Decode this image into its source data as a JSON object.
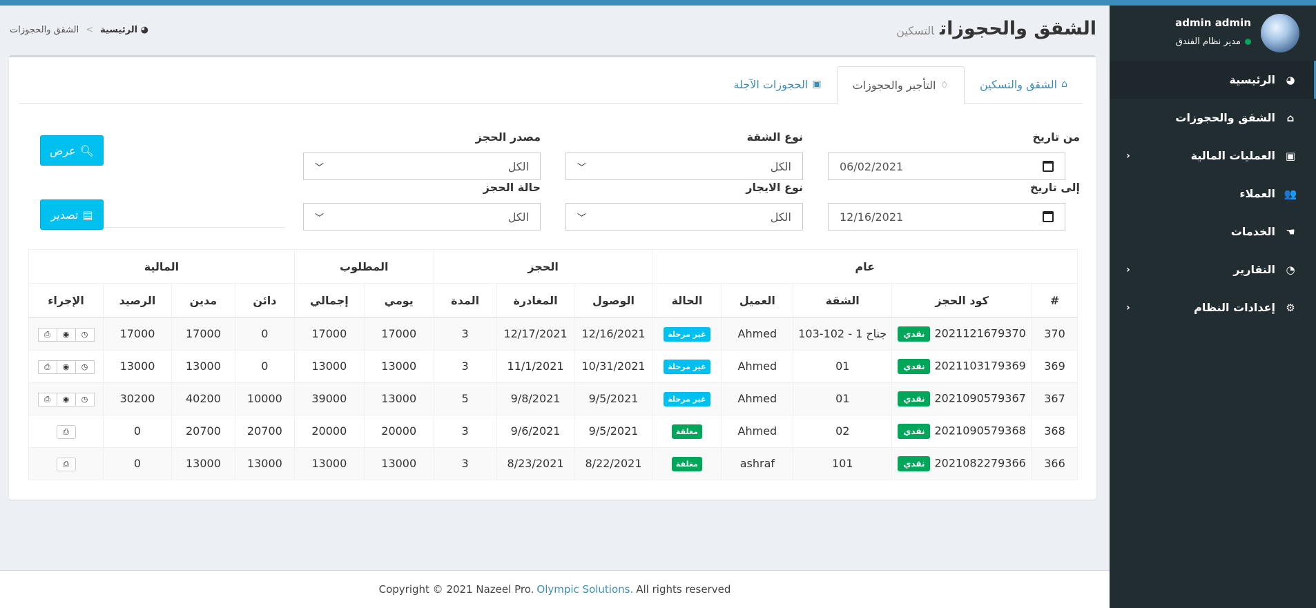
{
  "user": {
    "name": "admin admin",
    "role": "مدير نظام الفندق"
  },
  "sidebar": {
    "items": [
      {
        "label": "الرئيسية",
        "icon": "dashboard-icon",
        "active": true
      },
      {
        "label": "الشقق والحجوزات",
        "icon": "home-icon"
      },
      {
        "label": "العمليات المالية",
        "icon": "money-icon",
        "expandable": true
      },
      {
        "label": "العملاء",
        "icon": "users-icon"
      },
      {
        "label": "الخدمات",
        "icon": "hand-icon"
      },
      {
        "label": "التقارير",
        "icon": "pie-chart-icon",
        "expandable": true
      },
      {
        "label": "إعدادات النظام",
        "icon": "gears-icon",
        "expandable": true
      }
    ]
  },
  "header": {
    "title": "الشقق والحجوزات",
    "subtitle": "التسكين"
  },
  "breadcrumb": {
    "home": "الرئيسية",
    "current": "الشقق والحجوزات"
  },
  "tabs": [
    {
      "label": "الشقق والتسكين",
      "icon": "home-icon"
    },
    {
      "label": "التأجير والحجوزات",
      "icon": "lightbulb-icon",
      "active": true
    },
    {
      "label": "الحجوزات الآجلة",
      "icon": "money-icon"
    }
  ],
  "filters": {
    "from_date": {
      "label": "من تاريخ",
      "value": "06/02/2021"
    },
    "to_date": {
      "label": "إلى تاريخ",
      "value": "12/16/2021"
    },
    "apartment_type": {
      "label": "نوع الشقة",
      "value": "الكل"
    },
    "rent_type": {
      "label": "نوع الايجار",
      "value": "الكل"
    },
    "booking_source": {
      "label": "مصدر الحجز",
      "value": "الكل"
    },
    "booking_status": {
      "label": "حالة الحجز",
      "value": "الكل"
    }
  },
  "buttons": {
    "view": "عرض",
    "export": "تصدير"
  },
  "table": {
    "groups": {
      "general": "عام",
      "booking": "الحجز",
      "required": "المطلوب",
      "financial": "المالية"
    },
    "columns": {
      "num": "#",
      "code": "كود الحجز",
      "apartment": "الشقة",
      "client": "العميل",
      "status": "الحالة",
      "arrival": "الوصول",
      "departure": "المغادرة",
      "duration": "المدة",
      "daily": "يومي",
      "total": "إجمالي",
      "credit": "دائن",
      "debit": "مدين",
      "balance": "الرصيد",
      "action": "الإجراء"
    },
    "rows": [
      {
        "num": "370",
        "code": "2021121679370",
        "pay": "نقدي",
        "apartment": "جناح 1 - 102-103",
        "client": "Ahmed",
        "status": "غير مرحلة",
        "status_kind": "open",
        "arrival": "12/16/2021",
        "departure": "12/17/2021",
        "duration": "3",
        "daily": "17000",
        "total": "17000",
        "credit": "0",
        "debit": "17000",
        "balance": "17000",
        "actions": [
          "print",
          "view",
          "clock"
        ]
      },
      {
        "num": "369",
        "code": "2021103179369",
        "pay": "نقدي",
        "apartment": "01",
        "client": "Ahmed",
        "status": "غير مرحلة",
        "status_kind": "open",
        "arrival": "10/31/2021",
        "departure": "11/1/2021",
        "duration": "3",
        "daily": "13000",
        "total": "13000",
        "credit": "0",
        "debit": "13000",
        "balance": "13000",
        "actions": [
          "print",
          "view",
          "clock"
        ]
      },
      {
        "num": "367",
        "code": "2021090579367",
        "pay": "نقدي",
        "apartment": "01",
        "client": "Ahmed",
        "status": "غير مرحلة",
        "status_kind": "open",
        "arrival": "9/5/2021",
        "departure": "9/8/2021",
        "duration": "5",
        "daily": "13000",
        "total": "39000",
        "credit": "10000",
        "debit": "40200",
        "balance": "30200",
        "actions": [
          "print",
          "view",
          "clock"
        ]
      },
      {
        "num": "368",
        "code": "2021090579368",
        "pay": "نقدي",
        "apartment": "02",
        "client": "Ahmed",
        "status": "مغلقة",
        "status_kind": "closed",
        "arrival": "9/5/2021",
        "departure": "9/6/2021",
        "duration": "3",
        "daily": "20000",
        "total": "20000",
        "credit": "20700",
        "debit": "20700",
        "balance": "0",
        "actions": [
          "print"
        ]
      },
      {
        "num": "366",
        "code": "2021082279366",
        "pay": "نقدي",
        "apartment": "101",
        "client": "ashraf",
        "status": "مغلقة",
        "status_kind": "closed",
        "arrival": "8/22/2021",
        "departure": "8/23/2021",
        "duration": "3",
        "daily": "13000",
        "total": "13000",
        "credit": "13000",
        "debit": "13000",
        "balance": "0",
        "actions": [
          "print"
        ]
      }
    ]
  },
  "footer": {
    "prefix": "Copyright © 2021 Nazeel Pro.",
    "link": "Olympic Solutions.",
    "suffix": "All rights reserved"
  }
}
